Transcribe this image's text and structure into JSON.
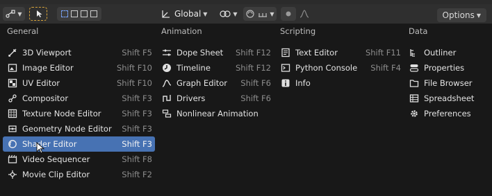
{
  "header": {
    "pivot_label": "Global",
    "options_label": "Options"
  },
  "menu": {
    "columns": [
      {
        "title": "General",
        "items": [
          {
            "label": "3D Viewport",
            "shortcut": "Shift F5",
            "icon": "viewport-3d-icon"
          },
          {
            "label": "Image Editor",
            "shortcut": "Shift F10",
            "icon": "image-editor-icon"
          },
          {
            "label": "UV Editor",
            "shortcut": "Shift F10",
            "icon": "uv-editor-icon"
          },
          {
            "label": "Compositor",
            "shortcut": "Shift F3",
            "icon": "compositor-icon"
          },
          {
            "label": "Texture Node Editor",
            "shortcut": "Shift F3",
            "icon": "texture-node-icon"
          },
          {
            "label": "Geometry Node Editor",
            "shortcut": "Shift F3",
            "icon": "geometry-node-icon"
          },
          {
            "label": "Shader Editor",
            "shortcut": "Shift F3",
            "icon": "shader-editor-icon"
          },
          {
            "label": "Video Sequencer",
            "shortcut": "Shift F8",
            "icon": "video-sequencer-icon"
          },
          {
            "label": "Movie Clip Editor",
            "shortcut": "Shift F2",
            "icon": "movie-clip-icon"
          }
        ]
      },
      {
        "title": "Animation",
        "items": [
          {
            "label": "Dope Sheet",
            "shortcut": "Shift F12",
            "icon": "dope-sheet-icon"
          },
          {
            "label": "Timeline",
            "shortcut": "Shift F12",
            "icon": "timeline-icon"
          },
          {
            "label": "Graph Editor",
            "shortcut": "Shift F6",
            "icon": "graph-editor-icon"
          },
          {
            "label": "Drivers",
            "shortcut": "Shift F6",
            "icon": "drivers-icon"
          },
          {
            "label": "Nonlinear Animation",
            "shortcut": "",
            "icon": "nla-icon"
          }
        ]
      },
      {
        "title": "Scripting",
        "items": [
          {
            "label": "Text Editor",
            "shortcut": "Shift F11",
            "icon": "text-editor-icon"
          },
          {
            "label": "Python Console",
            "shortcut": "Shift F4",
            "icon": "python-console-icon"
          },
          {
            "label": "Info",
            "shortcut": "",
            "icon": "info-icon"
          }
        ]
      },
      {
        "title": "Data",
        "items": [
          {
            "label": "Outliner",
            "shortcut": "",
            "icon": "outliner-icon"
          },
          {
            "label": "Properties",
            "shortcut": "",
            "icon": "properties-icon"
          },
          {
            "label": "File Browser",
            "shortcut": "",
            "icon": "file-browser-icon"
          },
          {
            "label": "Spreadsheet",
            "shortcut": "",
            "icon": "spreadsheet-icon"
          },
          {
            "label": "Preferences",
            "shortcut": "",
            "icon": "preferences-icon"
          }
        ]
      }
    ],
    "highlighted_item": "Shader Editor"
  },
  "colors": {
    "highlight": "#4772b3",
    "menu_bg": "#181818",
    "header_bg": "#2f2f2f"
  }
}
